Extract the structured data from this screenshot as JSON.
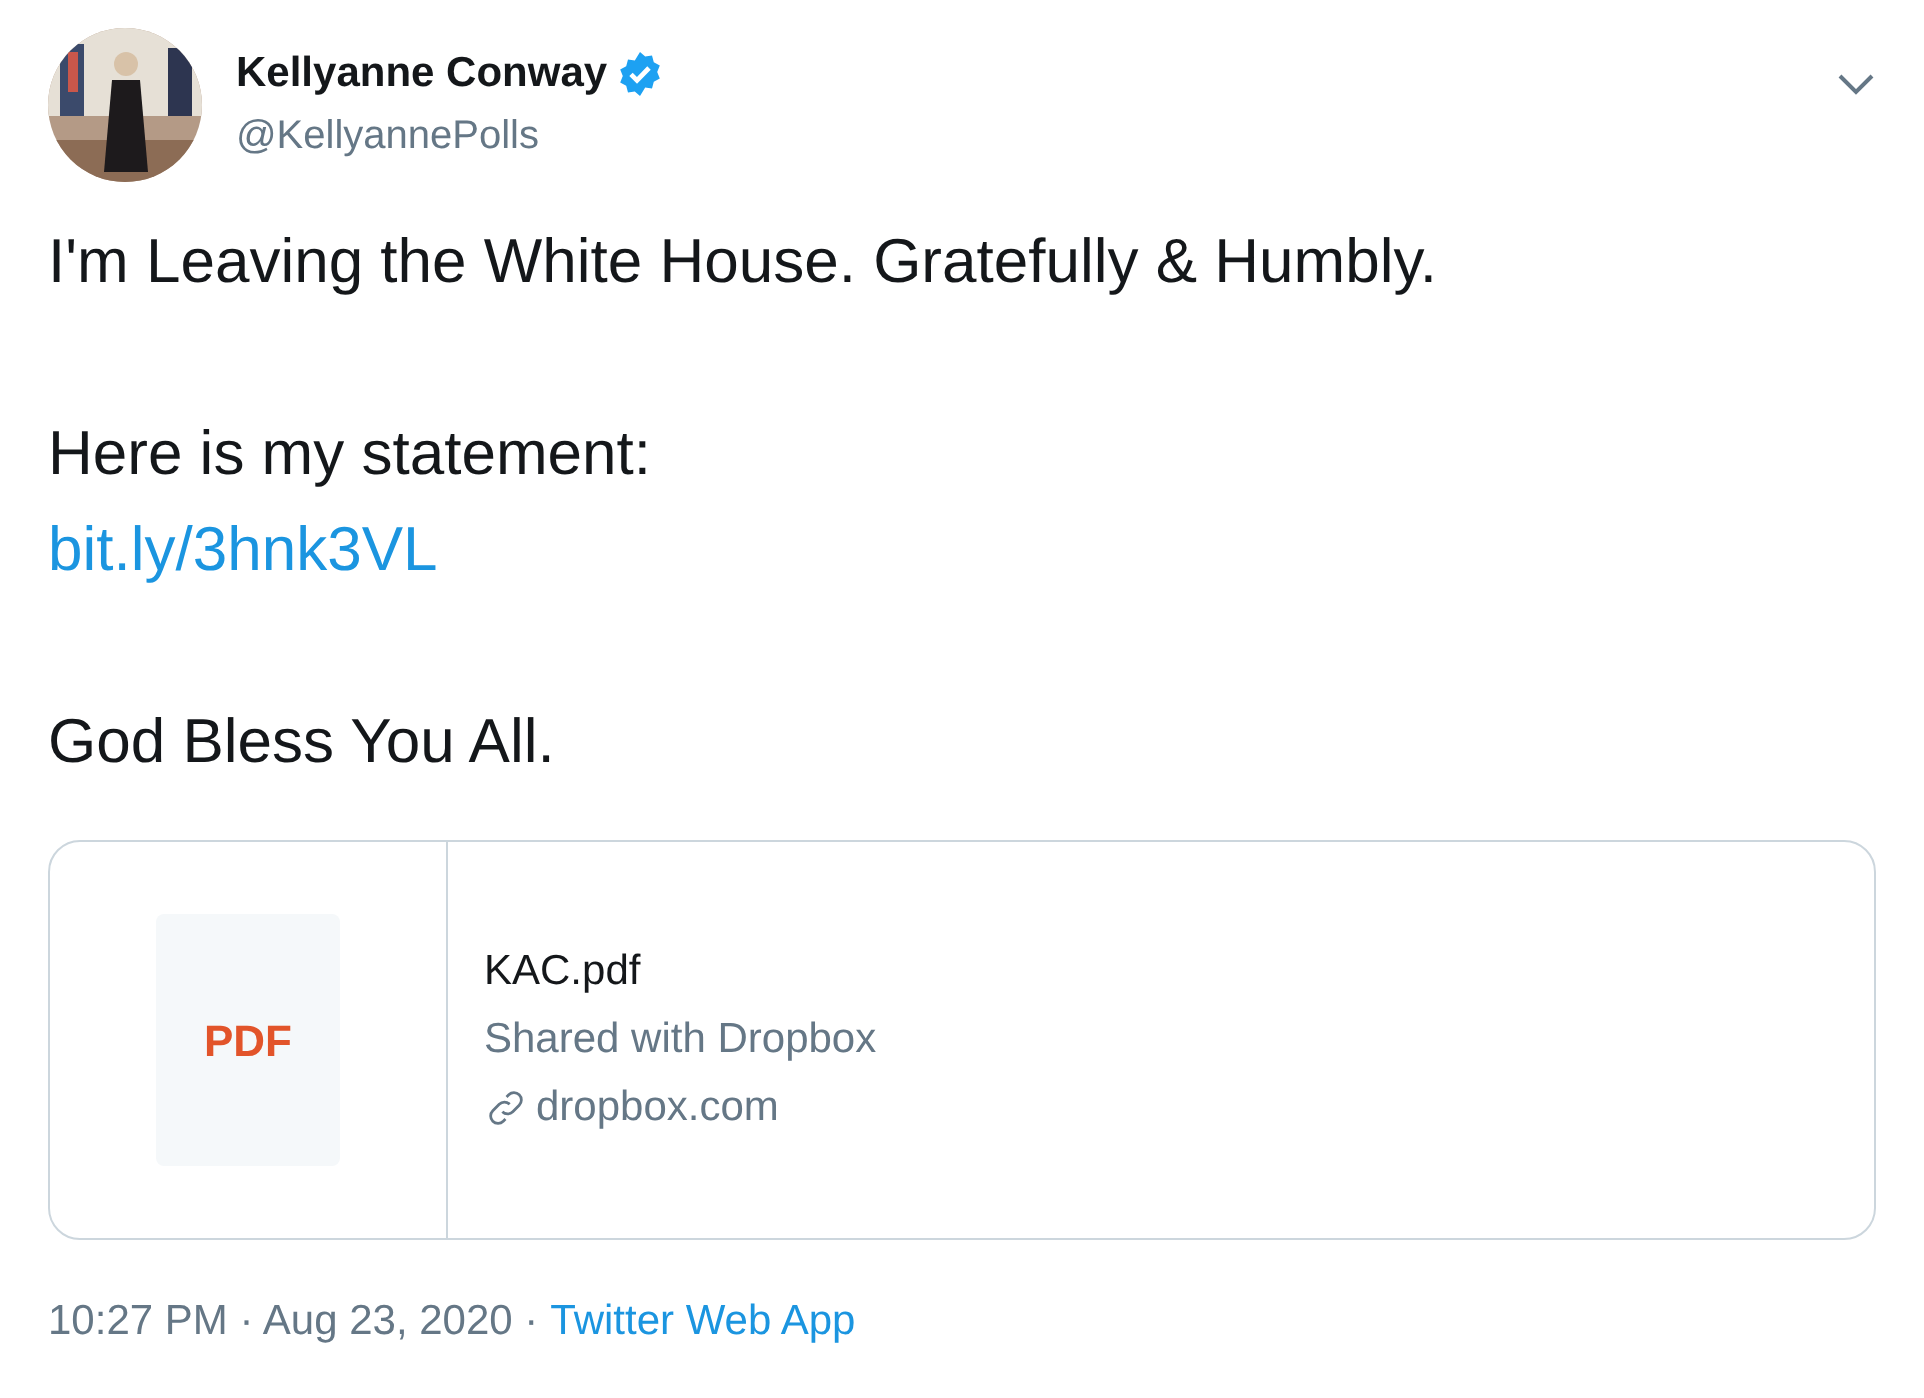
{
  "author": {
    "name": "Kellyanne Conway",
    "verified": true,
    "handle": "@KellyannePolls"
  },
  "paragraphs": [
    {
      "lines": [
        {
          "kind": "text",
          "text": "I'm Leaving the White House. Gratefully & Humbly."
        }
      ]
    },
    {
      "lines": [
        {
          "kind": "text",
          "text": "Here is my statement:"
        },
        {
          "kind": "link",
          "text": "bit.ly/3hnk3VL"
        }
      ]
    },
    {
      "lines": [
        {
          "kind": "text",
          "text": "God Bless You All."
        }
      ]
    }
  ],
  "card": {
    "badge": "PDF",
    "title": "KAC.pdf",
    "description": "Shared with Dropbox",
    "domain": "dropbox.com"
  },
  "footer": {
    "meta": "10:27 PM · Aug 23, 2020 ·",
    "source": "Twitter Web App"
  }
}
